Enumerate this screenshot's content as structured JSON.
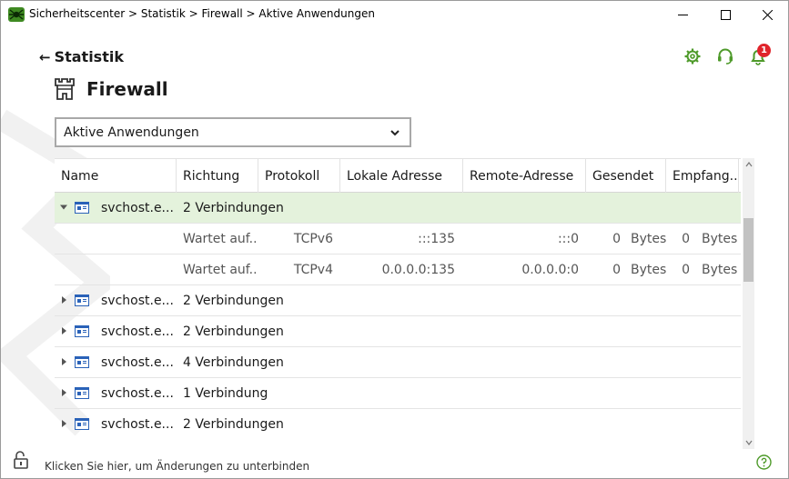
{
  "window": {
    "title": "Sicherheitscenter > Statistik > Firewall > Aktive Anwendungen",
    "accent_color": "#4e9a2a",
    "selected_row_color": "#e4f2dc"
  },
  "header": {
    "back_label": "Statistik",
    "page_title": "Firewall",
    "notification_count": "1"
  },
  "dropdown": {
    "selected": "Aktive Anwendungen"
  },
  "table": {
    "columns": [
      "Name",
      "Richtung",
      "Protokoll",
      "Lokale Adresse",
      "Remote-Adresse",
      "Gesendet",
      "Empfang..."
    ],
    "rows": [
      {
        "type": "group",
        "expanded": true,
        "name": "svchost.e...",
        "direction": "2 Verbindungen"
      },
      {
        "type": "connection",
        "direction": "Wartet auf...",
        "protocol": "TCPv6",
        "local": ":::135",
        "remote": ":::0",
        "sent_num": "0",
        "sent_unit": "Bytes",
        "recv_num": "0",
        "recv_unit": "Bytes"
      },
      {
        "type": "connection",
        "direction": "Wartet auf...",
        "protocol": "TCPv4",
        "local": "0.0.0.0:135",
        "remote": "0.0.0.0:0",
        "sent_num": "0",
        "sent_unit": "Bytes",
        "recv_num": "0",
        "recv_unit": "Bytes"
      },
      {
        "type": "group",
        "expanded": false,
        "name": "svchost.e...",
        "direction": "2 Verbindungen"
      },
      {
        "type": "group",
        "expanded": false,
        "name": "svchost.e...",
        "direction": "2 Verbindungen"
      },
      {
        "type": "group",
        "expanded": false,
        "name": "svchost.e...",
        "direction": "4 Verbindungen"
      },
      {
        "type": "group",
        "expanded": false,
        "name": "svchost.e...",
        "direction": "1 Verbindung"
      },
      {
        "type": "group",
        "expanded": false,
        "name": "svchost.e...",
        "direction": "2 Verbindungen"
      }
    ]
  },
  "footer": {
    "lock_text": "Klicken Sie hier, um Änderungen zu unterbinden"
  },
  "icons": {
    "app": "dr-web-spider-icon",
    "castle": "castle-icon",
    "settings": "gear-icon",
    "support": "headset-icon",
    "notifications": "bell-icon",
    "lock": "padlock-open-icon",
    "help": "question-circle-icon"
  }
}
